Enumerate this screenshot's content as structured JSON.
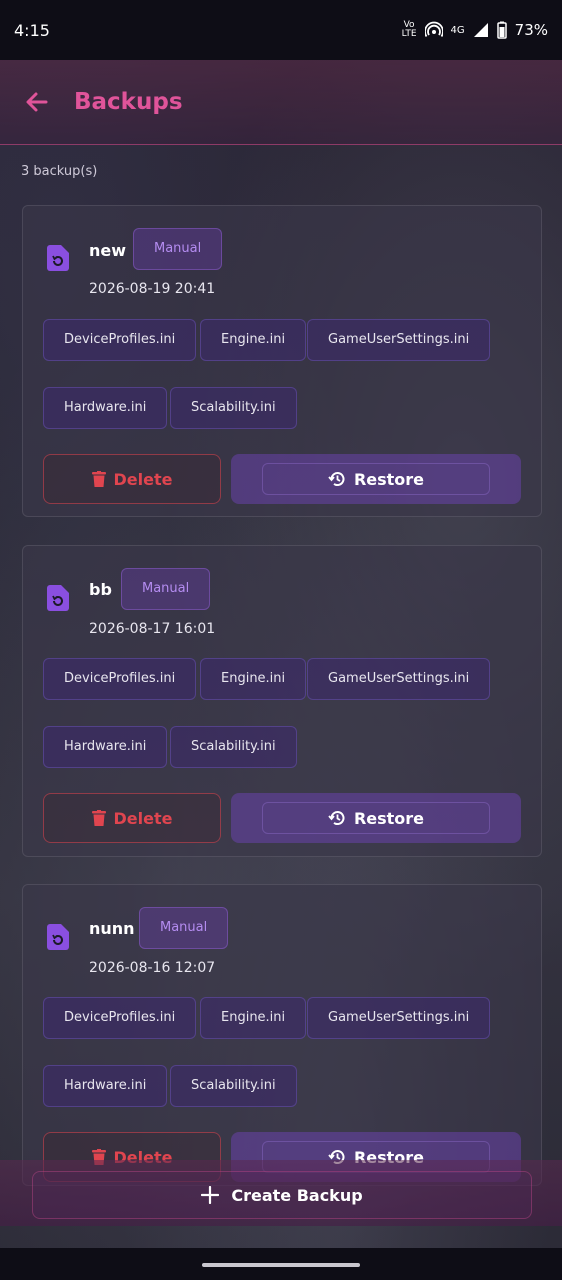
{
  "status": {
    "time": "4:15",
    "volte_top": "Vo",
    "volte_bottom": "LTE",
    "network": "4G",
    "battery": "73%"
  },
  "header": {
    "title": "Backups"
  },
  "summary": {
    "count_text": "3 backup(s)"
  },
  "backups": [
    {
      "name": "new",
      "type": "Manual",
      "date": "2026-08-19 20:41",
      "files": [
        "DeviceProfiles.ini",
        "Engine.ini",
        "GameUserSettings.ini",
        "Hardware.ini",
        "Scalability.ini"
      ]
    },
    {
      "name": "bb",
      "type": "Manual",
      "date": "2026-08-17 16:01",
      "files": [
        "DeviceProfiles.ini",
        "Engine.ini",
        "GameUserSettings.ini",
        "Hardware.ini",
        "Scalability.ini"
      ]
    },
    {
      "name": "nunn",
      "type": "Manual",
      "date": "2026-08-16 12:07",
      "files": [
        "DeviceProfiles.ini",
        "Engine.ini",
        "GameUserSettings.ini",
        "Hardware.ini",
        "Scalability.ini"
      ]
    }
  ],
  "actions": {
    "delete_label": "Delete",
    "restore_label": "Restore",
    "create_label": "Create Backup"
  },
  "colors": {
    "accent": "#e0549a",
    "purple": "#8a4fe0",
    "danger": "#e0454f"
  },
  "icons": {
    "back": "arrow-left-icon",
    "backup_file": "file-restore-icon",
    "delete": "trash-icon",
    "restore": "history-icon",
    "create": "plus-icon"
  }
}
